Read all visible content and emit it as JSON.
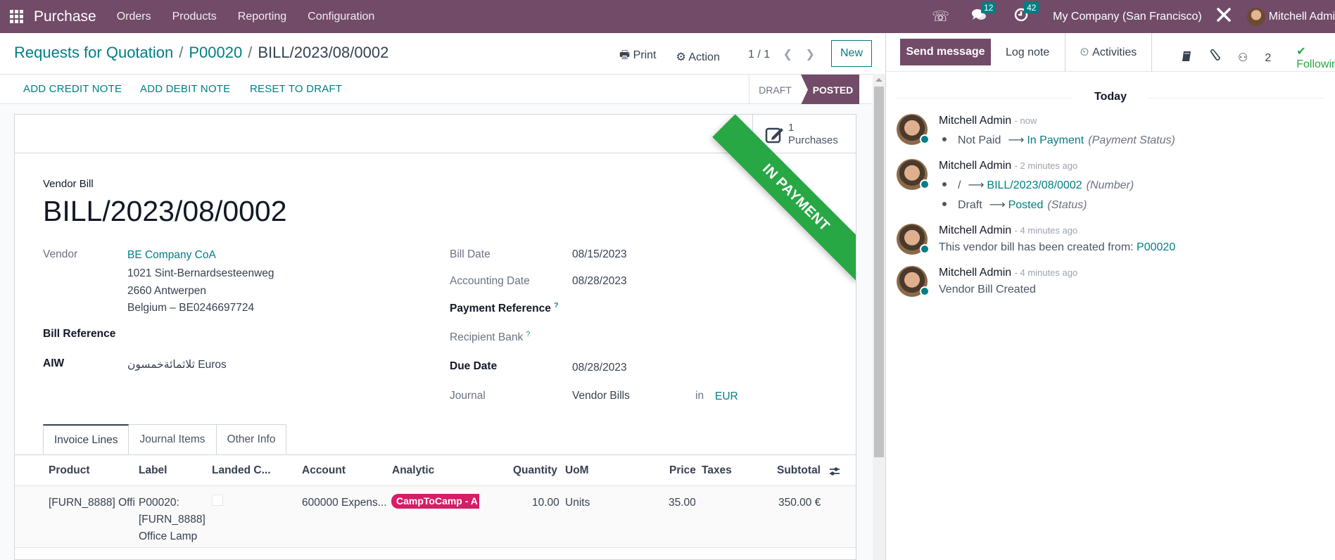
{
  "navbar": {
    "app_name": "Purchase",
    "menu": [
      "Orders",
      "Products",
      "Reporting",
      "Configuration"
    ],
    "icons": {
      "phone": "phone-icon",
      "chat": "chat-icon",
      "activity": "clock-icon",
      "debug": "tools-icon"
    },
    "chat_count": "12",
    "activity_count": "42",
    "company": "My Company (San Francisco)",
    "user": "Mitchell Admi"
  },
  "breadcrumb": {
    "items": [
      "Requests for Quotation",
      "P00020"
    ],
    "current": "BILL/2023/08/0002"
  },
  "toolbar": {
    "print": "Print",
    "action": "Action",
    "pager": "1 / 1",
    "new": "New"
  },
  "buttons": {
    "credit_note": "ADD CREDIT NOTE",
    "debit_note": "ADD DEBIT NOTE",
    "reset": "RESET TO DRAFT"
  },
  "status": {
    "draft": "DRAFT",
    "posted": "POSTED",
    "current": "POSTED"
  },
  "smart_button": {
    "count": "1",
    "label": "Purchases"
  },
  "ribbon": "IN PAYMENT",
  "form": {
    "doc_type": "Vendor Bill",
    "name": "BILL/2023/08/0002",
    "vendor_label": "Vendor",
    "vendor": "BE Company CoA",
    "address": [
      "1021 Sint-Bernardsesteenweg",
      "2660 Antwerpen",
      "Belgium – BE0246697724"
    ],
    "bill_ref_label": "Bill Reference",
    "aiw_label": "AIW",
    "aiw_value": "ثلاثمائةخمسون Euros",
    "bill_date_label": "Bill Date",
    "bill_date": "08/15/2023",
    "acc_date_label": "Accounting Date",
    "acc_date": "08/28/2023",
    "pay_ref_label": "Payment Reference",
    "bank_label": "Recipient Bank",
    "due_label": "Due Date",
    "due_date": "08/28/2023",
    "journal_label": "Journal",
    "journal": "Vendor Bills",
    "in": "in",
    "currency": "EUR",
    "help": "?"
  },
  "tabs": [
    "Invoice Lines",
    "Journal Items",
    "Other Info"
  ],
  "lines": {
    "headers": [
      "Product",
      "Label",
      "Landed C...",
      "Account",
      "Analytic",
      "Quantity",
      "UoM",
      "Price",
      "Taxes",
      "Subtotal"
    ],
    "rows": [
      {
        "product": "[FURN_8888] Offi",
        "label": [
          "P00020:",
          "[FURN_8888]",
          "Office Lamp"
        ],
        "landed": false,
        "account": "600000 Expens...",
        "analytic": "CampToCamp - A",
        "quantity": "10.00",
        "uom": "Units",
        "price": "35.00",
        "taxes": "",
        "subtotal": "350.00 €"
      }
    ]
  },
  "chatter": {
    "send_message": "Send message",
    "log_note": "Log note",
    "activities": "Activities",
    "followers": "2",
    "following": "Following",
    "today": "Today",
    "messages": [
      {
        "author": "Mitchell Admin",
        "time": "- now",
        "changes": [
          {
            "old": "Not Paid",
            "new": "In Payment",
            "field": "(Payment Status)"
          }
        ]
      },
      {
        "author": "Mitchell Admin",
        "time": "- 2 minutes ago",
        "changes": [
          {
            "old": "/",
            "new": "BILL/2023/08/0002",
            "field": "(Number)"
          },
          {
            "old": "Draft",
            "new": "Posted",
            "field": "(Status)"
          }
        ]
      },
      {
        "author": "Mitchell Admin",
        "time": "- 4 minutes ago",
        "body": "This vendor bill has been created from:",
        "link": "P00020"
      },
      {
        "author": "Mitchell Admin",
        "time": "- 4 minutes ago",
        "body": "Vendor Bill Created"
      }
    ]
  }
}
